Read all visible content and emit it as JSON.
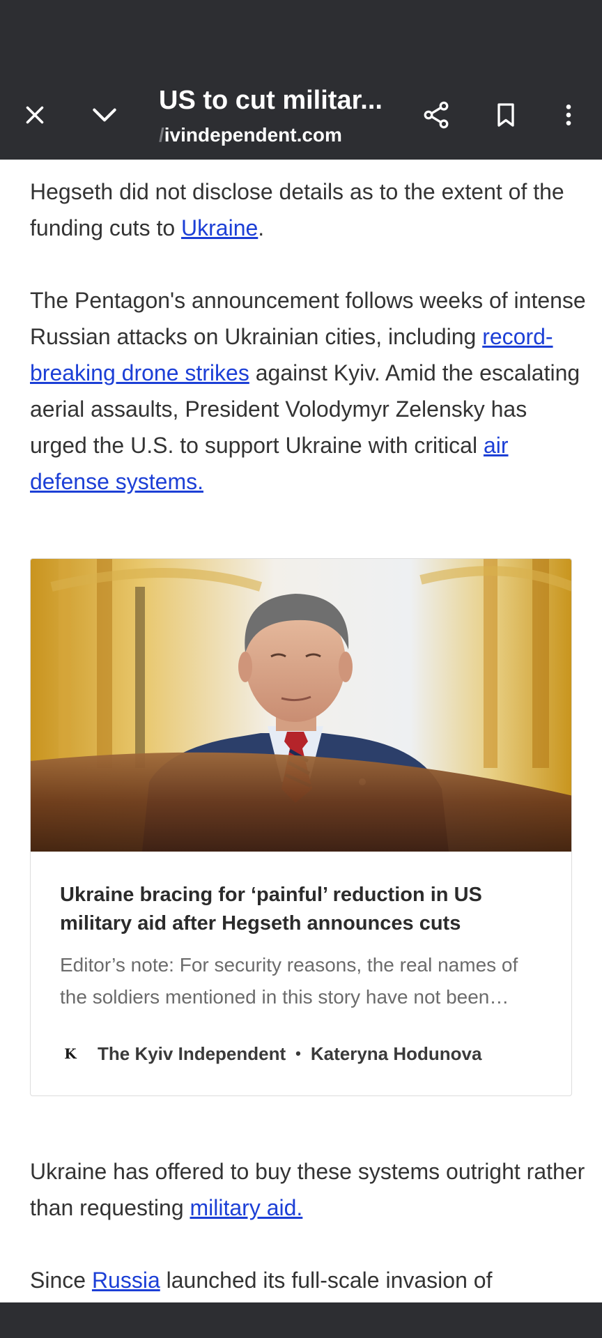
{
  "toolbar": {
    "title": "US to cut militar...",
    "url_faded": "/",
    "url": "ivindependent.com"
  },
  "article": {
    "p1": {
      "before": "Hegseth did not disclose details as to the extent of the funding cuts to ",
      "link": "Ukraine",
      "after": "."
    },
    "p2": {
      "before": "The Pentagon's announcement follows weeks of intense Russian attacks on Ukrainian cities, including ",
      "link1": "record-breaking drone strikes",
      "middle": " against Kyiv. Amid the escalating aerial assaults, President Volodymyr Zelensky has urged the U.S. to support Ukraine with critical ",
      "link2": "air defense systems."
    },
    "p3": {
      "before": "Ukraine has offered to buy these systems outright rather than requesting ",
      "link": "military aid."
    },
    "p4": {
      "before": "Since ",
      "link": "Russia",
      "after": " launched its full-scale invasion of"
    }
  },
  "card": {
    "title": "Ukraine bracing for ‘painful’ reduction in US military aid after Hegseth announces cuts",
    "snippet": "Editor’s note: For security reasons, the real names of the soldiers mentioned in this story have not been…",
    "logo_letter": "K",
    "publisher": "The Kyiv Independent",
    "separator": "•",
    "author": "Kateryna Hodunova"
  },
  "icons": [
    "close-icon",
    "chevron-down-icon",
    "share-icon",
    "bookmark-icon",
    "more-vert-icon"
  ],
  "colors": {
    "toolbar": "#2d2e32",
    "link": "#1c3fd6",
    "text": "#333333"
  }
}
